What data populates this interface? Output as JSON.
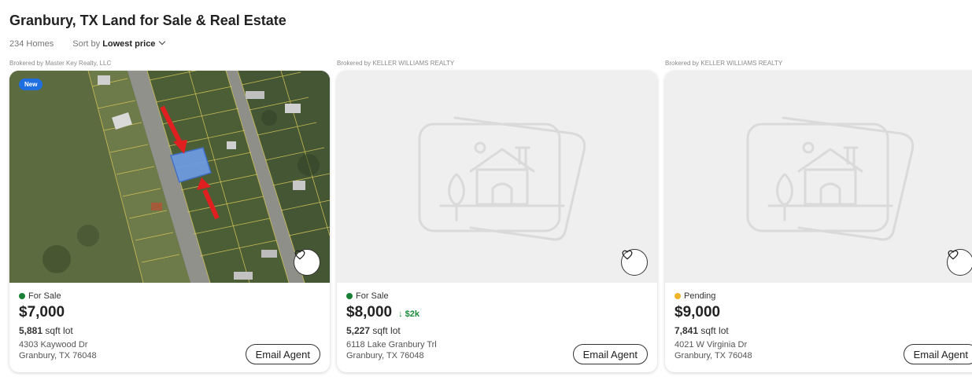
{
  "header": {
    "title": "Granbury, TX Land for Sale & Real Estate",
    "count": "234 Homes",
    "sort_label": "Sort by",
    "sort_value": "Lowest price"
  },
  "listings": [
    {
      "brokered": "Brokered by Master Key Realty, LLC",
      "badge": "New",
      "status": "For Sale",
      "status_color": "#1a7f37",
      "price": "$7,000",
      "price_drop": "",
      "lot_size": "5,881",
      "lot_unit": "sqft lot",
      "address_line1": "4303 Kaywood Dr",
      "address_line2": "Granbury, TX 76048",
      "email_label": "Email Agent",
      "photo": "aerial-map"
    },
    {
      "brokered": "Brokered by KELLER WILLIAMS REALTY",
      "badge": "",
      "status": "For Sale",
      "status_color": "#1a7f37",
      "price": "$8,000",
      "price_drop": "↓ $2k",
      "lot_size": "5,227",
      "lot_unit": "sqft lot",
      "address_line1": "6118 Lake Granbury Trl",
      "address_line2": "Granbury, TX 76048",
      "email_label": "Email Agent",
      "photo": "placeholder-house-icon"
    },
    {
      "brokered": "Brokered by KELLER WILLIAMS REALTY",
      "badge": "",
      "status": "Pending",
      "status_color": "#f0b429",
      "price": "$9,000",
      "price_drop": "",
      "lot_size": "7,841",
      "lot_unit": "sqft lot",
      "address_line1": "4021 W Virginia Dr",
      "address_line2": "Granbury, TX 76048",
      "email_label": "Email Agent",
      "photo": "placeholder-house-icon"
    }
  ]
}
